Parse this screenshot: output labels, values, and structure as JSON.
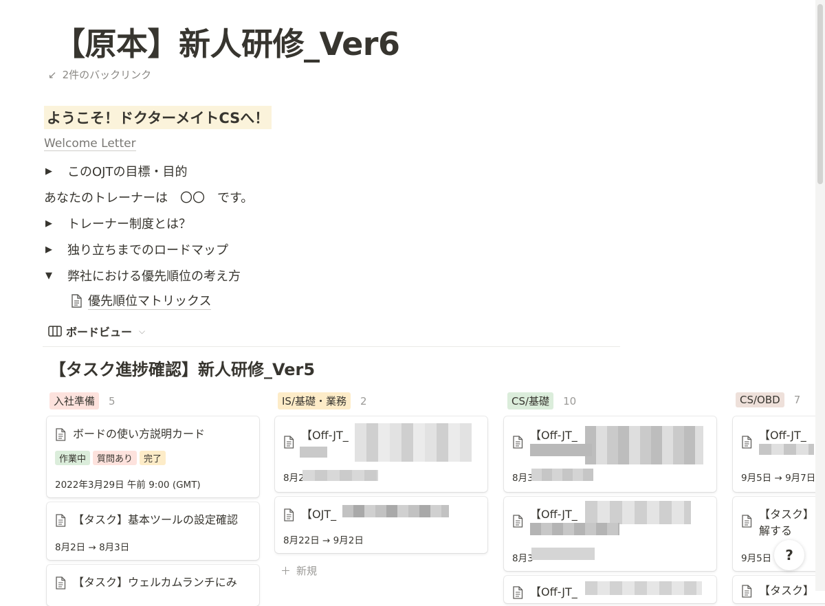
{
  "page": {
    "title": "【原本】新人研修_Ver6",
    "backlinks": "2件のバックリンク"
  },
  "welcome": {
    "heading": "ようこそ！ドクターメイトCSへ！",
    "letter_link": "Welcome Letter"
  },
  "blocks": {
    "toggle_goal": "このOJTの目標・目的",
    "trainer_line": "あなたのトレーナーは　〇〇　です。",
    "toggle_trainer": "トレーナー制度とは？",
    "toggle_roadmap": "独り立ちまでのロードマップ",
    "toggle_priority": "弊社における優先順位の考え方",
    "priority_subpage": "優先順位マトリックス"
  },
  "view": {
    "label": "ボードビュー",
    "board_title": "【タスク進捗確認】新人研修_Ver5"
  },
  "columns": [
    {
      "tag": "入社準備",
      "count": "5",
      "color": "#fde2dd"
    },
    {
      "tag": "IS/基礎・業務",
      "count": "2",
      "color": "#fdecc8"
    },
    {
      "tag": "CS/基礎",
      "count": "10",
      "color": "#dbeddb"
    },
    {
      "tag": "CS/OBD",
      "count": "7",
      "color": "#eee0da"
    }
  ],
  "cards": {
    "c1_1": {
      "title": "ボードの使い方説明カード",
      "chips": [
        "作業中",
        "質問あり",
        "完了"
      ],
      "date": "2022年3月29日 午前 9:00 (GMT)"
    },
    "c1_2": {
      "title": "【タスク】基本ツールの設定確認",
      "date": "8月2日 → 8月3日"
    },
    "c1_3": {
      "title": "【タスク】ウェルカムランチにみ"
    },
    "c2_1": {
      "title": "【Off-JT_",
      "date": "8月2"
    },
    "c2_2": {
      "title": "【OJT_",
      "date": "8月22日 → 9月2日"
    },
    "c3_1": {
      "title": "【Off-JT_",
      "date": "8月3"
    },
    "c3_2": {
      "title": "【Off-JT_",
      "date": "8月3"
    },
    "c3_3": {
      "title": "【Off-JT_"
    },
    "c4_1": {
      "title": "【Off-JT_",
      "date": "9月5日 → 9月7日"
    },
    "c4_2": {
      "title": "【タスク】",
      "title2": "解する",
      "date": "9月5日"
    },
    "c4_3": {
      "title": "【タスク】"
    }
  },
  "chip_colors": [
    "#dbeddb",
    "#fde2dd",
    "#fdecc8"
  ],
  "new_label": "新規",
  "help_label": "?"
}
